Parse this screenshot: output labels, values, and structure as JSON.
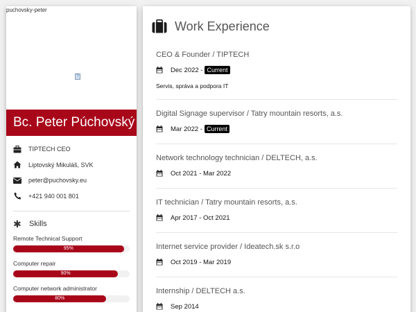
{
  "profile": {
    "photo_alt": "puchovsky-peter",
    "name": "Bc. Peter Púchovský",
    "contacts": [
      {
        "icon": "briefcase-icon",
        "text": "TIPTECH CEO"
      },
      {
        "icon": "home-icon",
        "text": "Liptovský Mikuláš, SVK"
      },
      {
        "icon": "envelope-icon",
        "text": "peter@puchovsky.eu"
      },
      {
        "icon": "phone-icon",
        "text": "+421 940 001 801"
      }
    ]
  },
  "skills": {
    "title": "Skills",
    "items": [
      {
        "label": "Remote Technical Support",
        "percent_label": "95%",
        "value": 95
      },
      {
        "label": "Computer repair",
        "percent_label": "90%",
        "value": 90
      },
      {
        "label": "Computer network administrator",
        "percent_label": "80%",
        "value": 80
      }
    ]
  },
  "experience": {
    "title": "Work Experience",
    "jobs": [
      {
        "title": "CEO & Founder / TIPTECH",
        "date": "Dec 2022 -",
        "badge": "Current",
        "desc": "Servis, správa a podpora IT"
      },
      {
        "title": "Digital Signage supervisor / Tatry mountain resorts, a.s.",
        "date": "Mar 2022 -",
        "badge": "Current",
        "desc": ""
      },
      {
        "title": "Network technology technician / DELTECH, a.s.",
        "date": "Oct 2021 - Mar 2022",
        "badge": "",
        "desc": ""
      },
      {
        "title": "IT technician / Tatry mountain resorts, a.s.",
        "date": "Apr 2017 - Oct 2021",
        "badge": "",
        "desc": ""
      },
      {
        "title": "Internet service provider / Ideatech.sk s.r.o",
        "date": "Oct 2019 - Mar 2019",
        "badge": "",
        "desc": ""
      },
      {
        "title": "Internship / DELTECH a.s.",
        "date": "Sep 2014",
        "badge": "",
        "desc": ""
      }
    ]
  },
  "colors": {
    "accent": "#a8071a",
    "badge": "#000000",
    "background": "#f1f1f1"
  }
}
